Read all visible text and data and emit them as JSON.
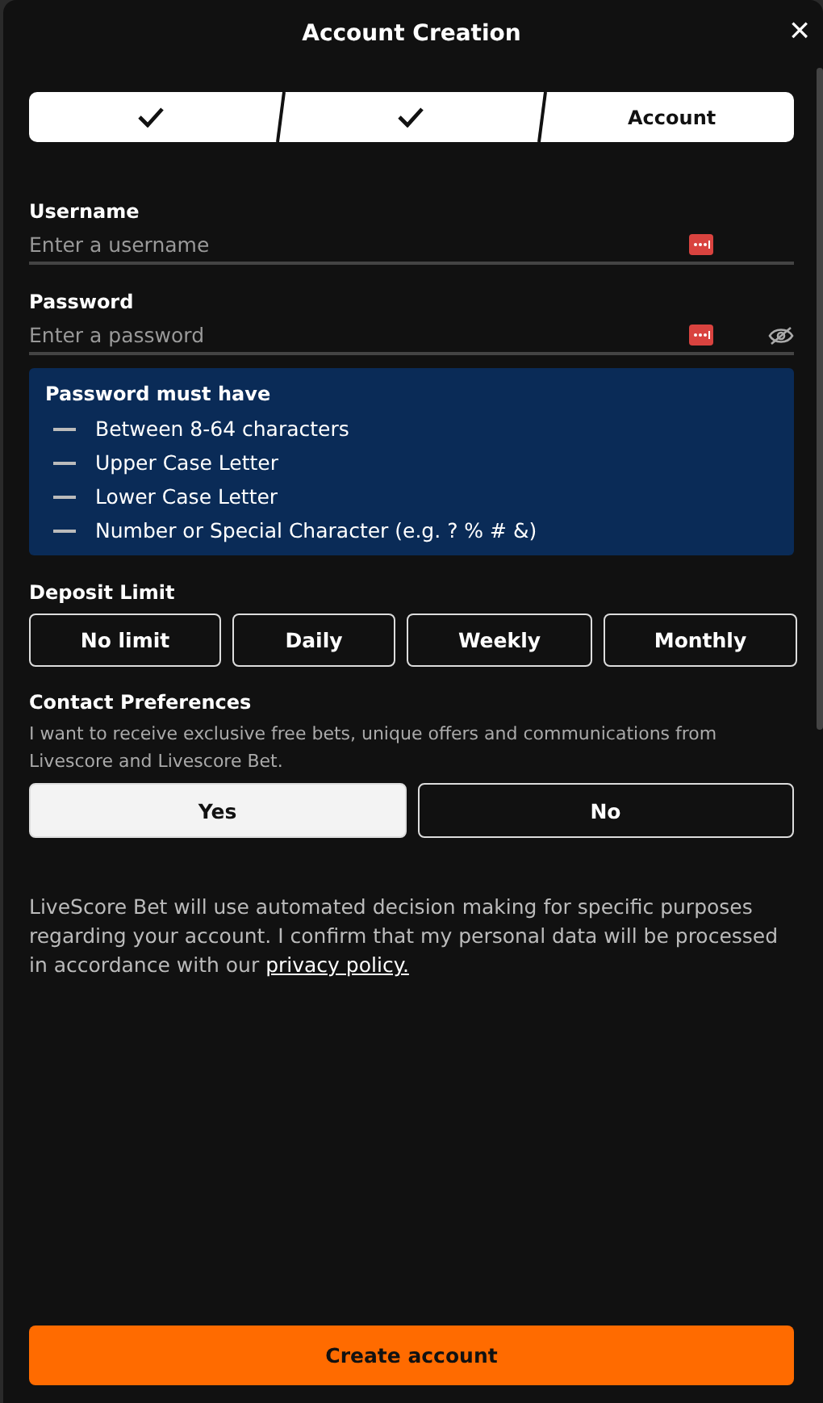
{
  "dialog": {
    "title": "Account Creation",
    "close": "×"
  },
  "steps": [
    {
      "done": true
    },
    {
      "done": true
    },
    {
      "label": "Account",
      "done": false
    }
  ],
  "fields": [
    {
      "label": "Username",
      "placeholder": "Enter a username",
      "secret": false
    },
    {
      "label": "Password",
      "placeholder": "Enter a password",
      "secret": true
    }
  ],
  "requirements": {
    "title": "Password must have",
    "items": [
      "Between 8-64 characters",
      "Upper Case Letter",
      "Lower Case Letter",
      "Number or Special Character (e.g. ? % # &)"
    ]
  },
  "deposit_limit": {
    "label": "Deposit Limit",
    "options": [
      {
        "label": "No limit",
        "selected": false
      },
      {
        "label": "Daily",
        "selected": false
      },
      {
        "label": "Weekly",
        "selected": false
      },
      {
        "label": "Monthly",
        "selected": false
      }
    ]
  },
  "contact": {
    "label": "Contact Preferences",
    "description": "I want to receive exclusive free bets, unique offers and communications from Livescore and Livescore Bet.",
    "options": [
      {
        "label": "Yes",
        "selected": true
      },
      {
        "label": "No",
        "selected": false
      }
    ]
  },
  "disclaimer": {
    "text": "LiveScore Bet will use automated decision making for specific purposes regarding your account. I confirm that my personal data will be processed in accordance with our ",
    "link": "privacy policy."
  },
  "submit": "Create account"
}
